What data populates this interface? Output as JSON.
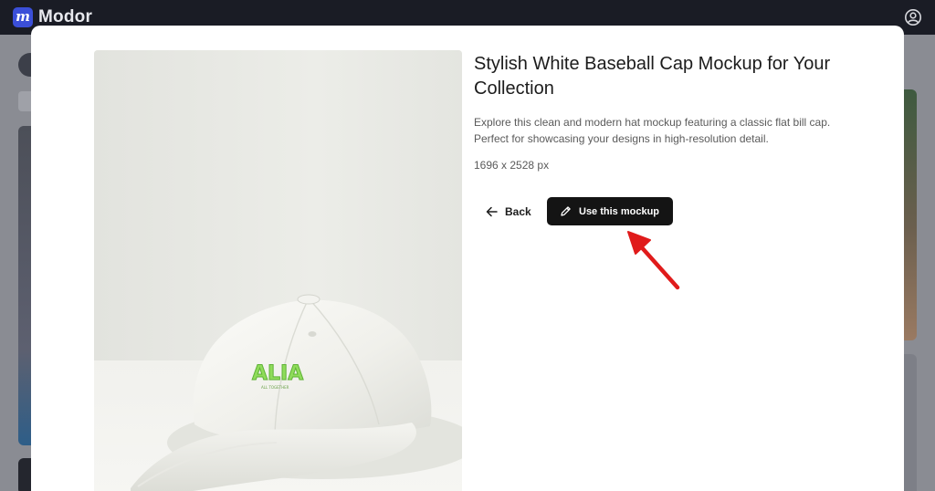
{
  "app": {
    "name": "Modor",
    "logo_letter": "m",
    "brand_color": "#3b4fd8"
  },
  "topbar": {
    "profile_icon": "user-circle-icon"
  },
  "modal": {
    "title": "Stylish White Baseball Cap Mockup for Your Collection",
    "description": "Explore this clean and modern hat mockup featuring a classic flat bill cap. Perfect for showcasing your designs in high-resolution detail.",
    "dimensions": "1696 x 2528 px",
    "back_label": "Back",
    "back_icon": "arrow-left-icon",
    "use_label": "Use this mockup",
    "use_icon": "pencil-icon",
    "preview_image": "white-baseball-cap-mockup",
    "cap_logo_text": "ALIA",
    "cap_logo_subtext": "ALL TOGETHER"
  },
  "annotation": {
    "pointer_color": "#e01b1b"
  }
}
